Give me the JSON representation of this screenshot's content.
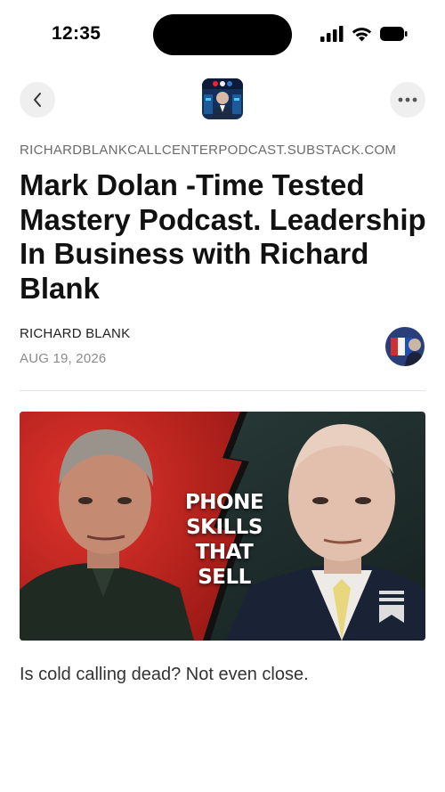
{
  "status_bar": {
    "time": "12:35",
    "icons": [
      "signal-icon",
      "wifi-icon",
      "battery-icon"
    ]
  },
  "nav": {
    "back_icon": "chevron-left-icon",
    "more_icon": "more-horizontal-icon",
    "publication_logo": "publication-logo"
  },
  "article": {
    "domain": "RICHARDBLANKCALLCENTERPODCAST.SUBSTACK.COM",
    "title": "Mark Dolan -Time Tested Mastery Podcast. Leadership In Business with Richard Blank",
    "author": "RICHARD BLANK",
    "date": "AUG 19, 2026",
    "hero": {
      "overlay_line1": "PHONE",
      "overlay_line2": "SKILLS",
      "overlay_line3": "THAT SELL"
    },
    "subtitle": "Is cold calling dead? Not even close."
  },
  "colors": {
    "hero_left_bg": "#c7241f",
    "hero_right_bg": "#20302e",
    "nav_button_bg": "#efefef",
    "domain_text": "#6b6b6b"
  }
}
